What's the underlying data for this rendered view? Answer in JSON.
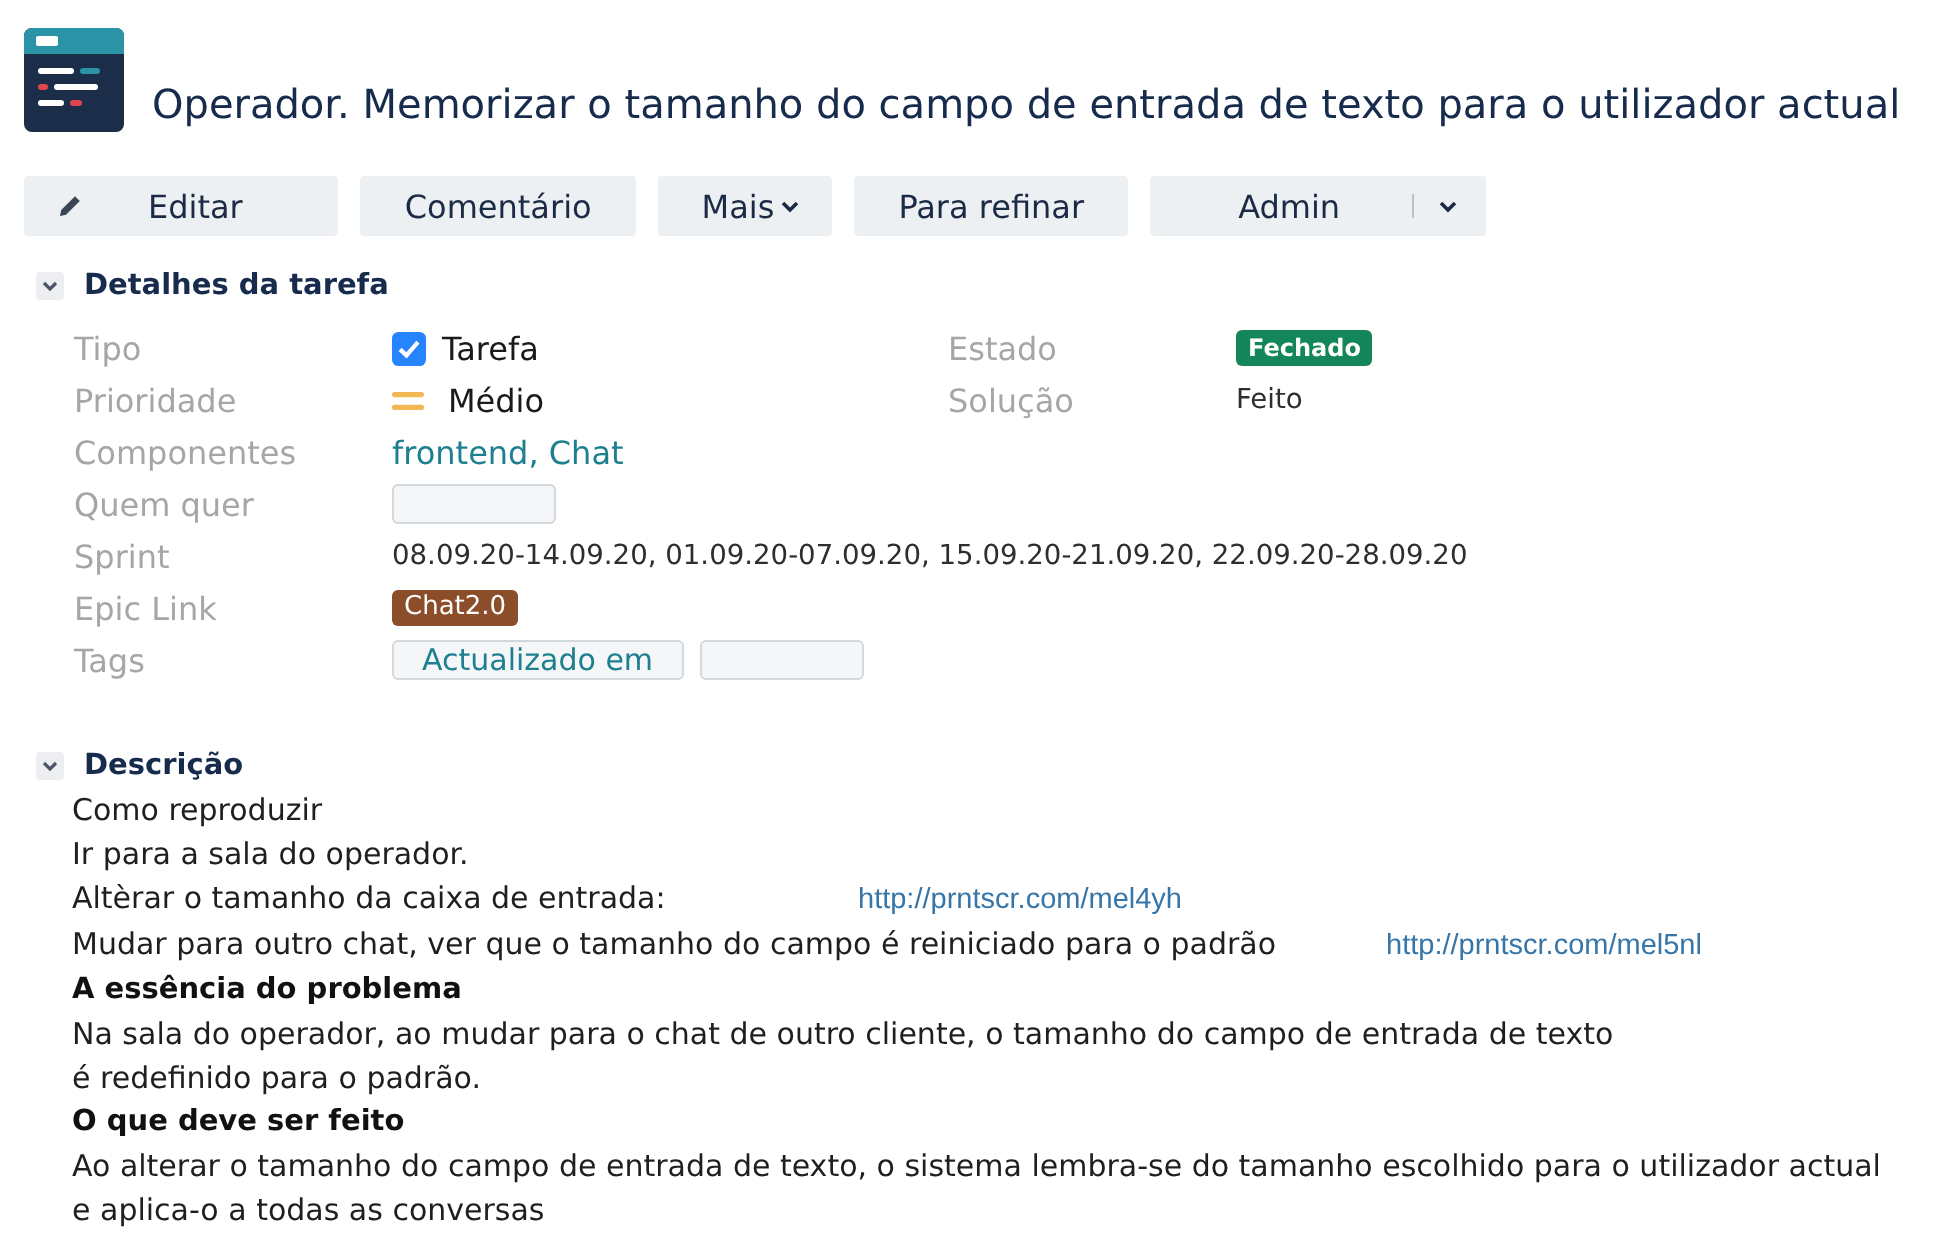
{
  "header": {
    "title": "Operador. Memorizar o tamanho do campo de entrada de texto para o utilizador actual"
  },
  "toolbar": [
    {
      "label": "Editar",
      "kind": "edit"
    },
    {
      "label": "Comentário",
      "kind": "plain"
    },
    {
      "label": "Mais",
      "kind": "dropdown"
    },
    {
      "label": "Para refinar",
      "kind": "plain"
    },
    {
      "label": "Admin",
      "kind": "split"
    }
  ],
  "details": {
    "title": "Detalhes da tarefa",
    "expanded": true,
    "left": [
      {
        "label": "Tipo",
        "kind": "type",
        "value": "Tarefa"
      },
      {
        "label": "Prioridade",
        "kind": "priority",
        "value": "Médio"
      },
      {
        "label": "Componentes",
        "kind": "links",
        "value": "frontend, Chat"
      },
      {
        "label": "Quem quer",
        "kind": "chips",
        "chips": [
          {
            "kind": "blank"
          }
        ]
      },
      {
        "label": "Sprint",
        "kind": "text",
        "value": "08.09.20-14.09.20, 01.09.20-07.09.20, 15.09.20-21.09.20, 22.09.20-28.09.20"
      },
      {
        "label": "Epic Link",
        "kind": "epic",
        "value": "Chat2.0"
      },
      {
        "label": "Tags",
        "kind": "chips",
        "chips": [
          {
            "kind": "label",
            "label": "Actualizado em"
          },
          {
            "kind": "blank"
          }
        ]
      }
    ],
    "right": [
      {
        "label": "Estado",
        "kind": "status",
        "value": "Fechado"
      },
      {
        "label": "Solução",
        "kind": "text",
        "value": "Feito"
      }
    ]
  },
  "description": {
    "title": "Descrição",
    "expanded": true,
    "blocks": [
      {
        "kind": "text",
        "text": "Como reproduzir"
      },
      {
        "kind": "text",
        "text": "Ir para a sala do operador."
      },
      {
        "kind": "text_link",
        "text": "Altèrar o tamanho da caixa de entrada:",
        "link": "http://prntscr.com/mel4yh"
      },
      {
        "kind": "text_link",
        "text": "Mudar para outro chat, ver que o tamanho do campo é reiniciado para o padrão",
        "link": "http://prntscr.com/mel5nl"
      },
      {
        "kind": "heading",
        "text": "A essência do problema"
      },
      {
        "kind": "text",
        "text": "Na sala do operador, ao mudar para o chat de outro cliente, o tamanho do campo de entrada de texto"
      },
      {
        "kind": "text",
        "text": "é redefinido para o padrão."
      },
      {
        "kind": "heading",
        "text": "O que deve ser feito"
      },
      {
        "kind": "text",
        "text": "Ao alterar o tamanho do campo de entrada de texto, o sistema lembra-se do tamanho escolhido para o utilizador actual"
      },
      {
        "kind": "text",
        "text": "e aplica-o a todas as conversas"
      }
    ]
  }
}
